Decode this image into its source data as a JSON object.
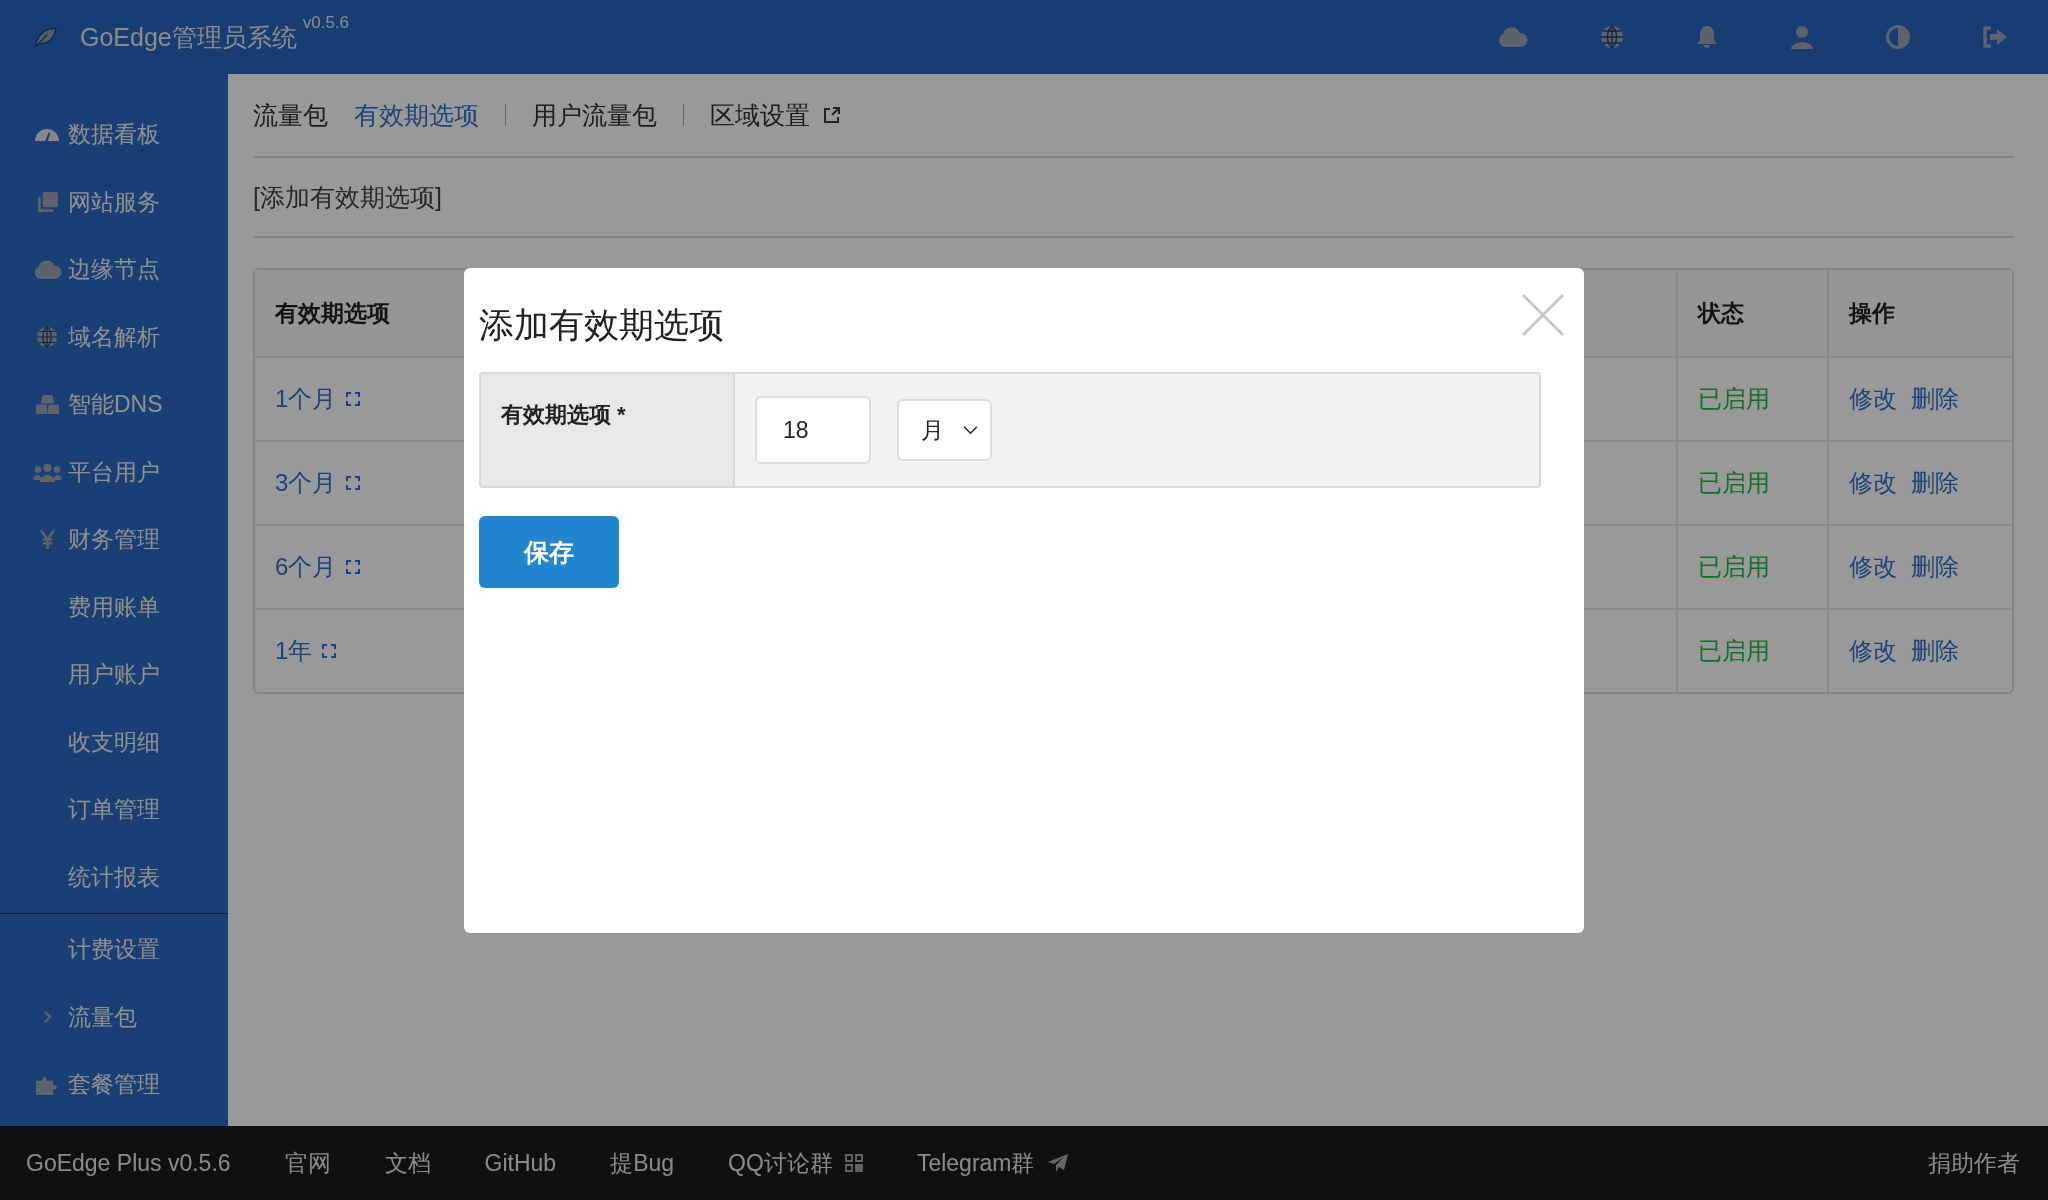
{
  "header": {
    "logo_text": "GoEdge管理员系统",
    "version": "v0.5.6"
  },
  "sidebar": {
    "sections": [
      [
        {
          "label": "数据看板",
          "kind": "module"
        },
        {
          "label": "网站服务",
          "kind": "module"
        },
        {
          "label": "边缘节点",
          "kind": "module"
        },
        {
          "label": "域名解析",
          "kind": "module"
        },
        {
          "label": "智能DNS",
          "kind": "module"
        },
        {
          "label": "平台用户",
          "kind": "module"
        },
        {
          "label": "财务管理",
          "kind": "module"
        },
        {
          "label": "费用账单",
          "kind": "sub"
        },
        {
          "label": "用户账户",
          "kind": "sub"
        },
        {
          "label": "收支明细",
          "kind": "sub"
        },
        {
          "label": "订单管理",
          "kind": "sub"
        },
        {
          "label": "统计报表",
          "kind": "sub"
        }
      ],
      [
        {
          "label": "计费设置",
          "kind": "sub"
        },
        {
          "label": "流量包",
          "kind": "group"
        },
        {
          "label": "套餐管理",
          "kind": "module"
        }
      ]
    ]
  },
  "tabs": [
    {
      "label": "流量包",
      "selected": false,
      "external": false
    },
    {
      "label": "有效期选项",
      "selected": true,
      "external": false
    },
    {
      "label": "用户流量包",
      "selected": false,
      "external": false
    },
    {
      "label": "区域设置",
      "selected": false,
      "external": true
    }
  ],
  "add_link": "[添加有效期选项]",
  "table": {
    "columns": [
      "有效期选项",
      "状态",
      "操作"
    ],
    "rows": [
      {
        "period": "1个月",
        "status": "已启用",
        "actions": [
          "修改",
          "删除"
        ]
      },
      {
        "period": "3个月",
        "status": "已启用",
        "actions": [
          "修改",
          "删除"
        ]
      },
      {
        "period": "6个月",
        "status": "已启用",
        "actions": [
          "修改",
          "删除"
        ]
      },
      {
        "period": "1年",
        "status": "已启用",
        "actions": [
          "修改",
          "删除"
        ]
      }
    ]
  },
  "dialog": {
    "title": "添加有效期选项",
    "field_label": "有效期选项",
    "required_mark": "*",
    "value": "18",
    "unit": "月",
    "button": "保存"
  },
  "footer": {
    "links": [
      {
        "label": "GoEdge Plus v0.5.6",
        "kind": "plain"
      },
      {
        "label": "官网",
        "kind": "plain"
      },
      {
        "label": "文档",
        "kind": "plain"
      },
      {
        "label": "GitHub",
        "kind": "plain"
      },
      {
        "label": "提Bug",
        "kind": "plain"
      },
      {
        "label": "QQ讨论群",
        "kind": "qr"
      },
      {
        "label": "Telegram群",
        "kind": "plane"
      }
    ],
    "right": "捐助作者"
  }
}
